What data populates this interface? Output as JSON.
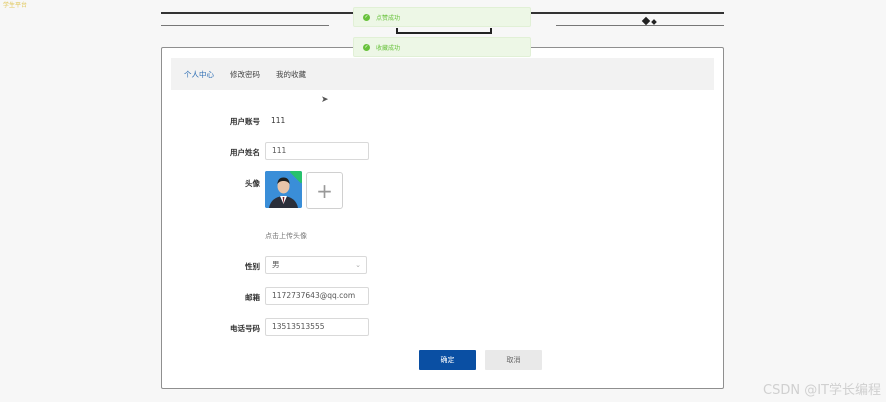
{
  "corner_logo": "学生平台",
  "toasts": [
    {
      "text": "点赞成功"
    },
    {
      "text": "收藏成功"
    }
  ],
  "tabs": [
    {
      "label": "个人中心",
      "active": true
    },
    {
      "label": "修改密码",
      "active": false
    },
    {
      "label": "我的收藏",
      "active": false
    }
  ],
  "form": {
    "account": {
      "label": "用户账号",
      "value": "111"
    },
    "name": {
      "label": "用户姓名",
      "value": "111"
    },
    "avatar": {
      "label": "头像",
      "hint": "点击上传头像"
    },
    "gender": {
      "label": "性别",
      "value": "男"
    },
    "email": {
      "label": "邮箱",
      "value": "1172737643@qq.com"
    },
    "phone": {
      "label": "电话号码",
      "value": "13513513555"
    }
  },
  "buttons": {
    "confirm": "确定",
    "cancel": "取消"
  },
  "watermark": "CSDN @IT学长编程",
  "colors": {
    "primary": "#0a4fa3",
    "success": "#67c23a",
    "active_tab": "#2b6cb3"
  }
}
